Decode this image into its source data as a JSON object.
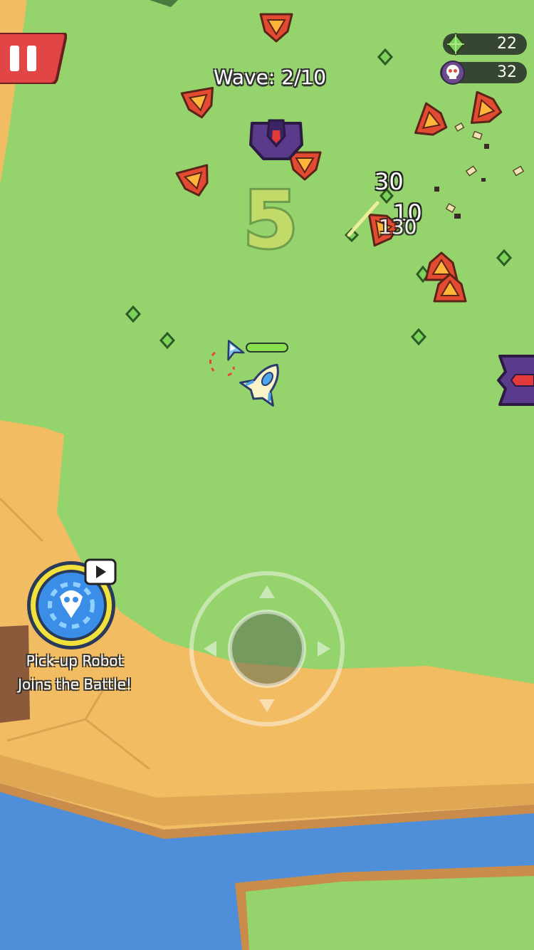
{
  "hud": {
    "gems": "22",
    "kills": "32",
    "wave_label": "Wave: 2/10",
    "countdown": "5"
  },
  "damage_numbers": [
    "30",
    "10",
    "130"
  ],
  "powerup": {
    "line1": "Pick-up Robot",
    "line2": "Joins the Battle!",
    "ad_icon": "video-play-icon"
  },
  "player": {
    "health": 1.0
  },
  "colors": {
    "grass": "#95d36c",
    "sand": "#f2bd62",
    "water": "#4f8fd9",
    "enemy_red": "#e34a32",
    "enemy_purple": "#5a3a8a",
    "gem_green": "#7bd35a",
    "pause_red": "#e24545"
  },
  "icons": [
    "pause-icon",
    "gem-icon",
    "skull-icon",
    "joystick-icon"
  ]
}
